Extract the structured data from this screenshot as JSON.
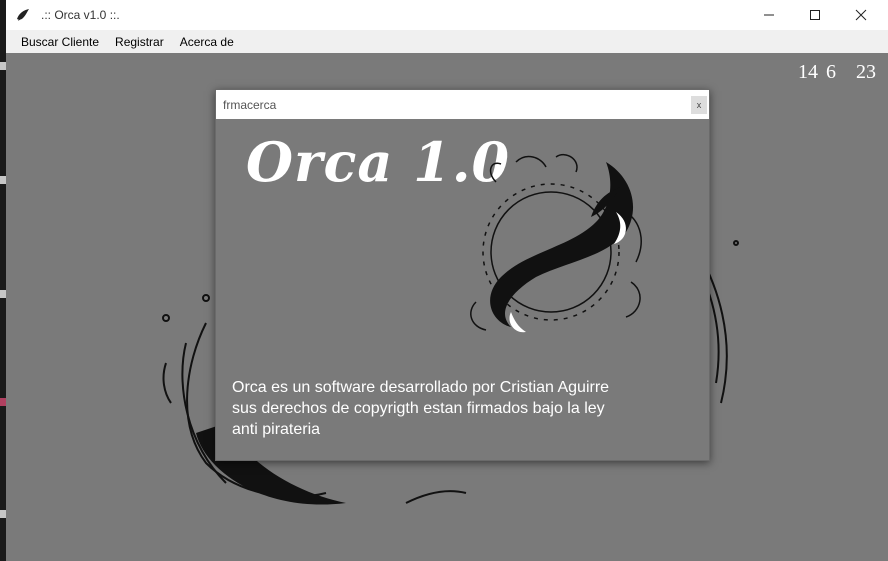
{
  "window": {
    "title": ".:: Orca v1.0 ::.",
    "app_icon": "orca-icon",
    "controls": [
      "minimize-icon",
      "maximize-icon",
      "close-icon"
    ]
  },
  "menu": {
    "items": [
      {
        "label": "Buscar Cliente"
      },
      {
        "label": "Registrar"
      },
      {
        "label": "Acerca de"
      }
    ]
  },
  "clock": {
    "hour": "14",
    "minute": "6",
    "second": "23"
  },
  "dialog": {
    "title": "frmacerca",
    "close_label": "x",
    "logo_text": "Orca 1.0",
    "description_lines": [
      "Orca es un software desarrollado por Cristian Aguirre",
      "sus derechos de copyrigth estan firmados bajo la ley",
      "anti pirateria"
    ]
  },
  "colors": {
    "background": "#7a7a7a",
    "titlebar": "#ffffff",
    "menubar": "#f0f0f0",
    "text_light": "#ffffff"
  }
}
